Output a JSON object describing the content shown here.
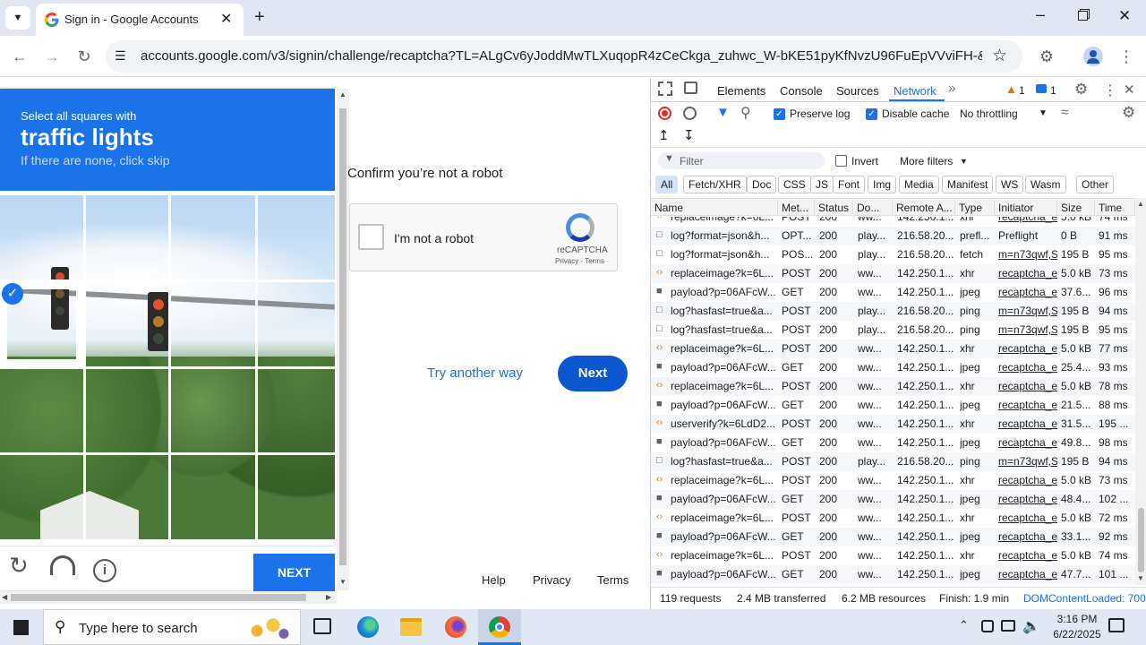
{
  "browser": {
    "tab_title": "Sign in - Google Accounts",
    "url": "accounts.google.com/v3/signin/challenge/recaptcha?TL=ALgCv6yJoddMwTLXuqopR4zCeCkga_zuhwc_W-bKE51pyKfNvzU96FuEpVVviFH-&checkConn..."
  },
  "captcha": {
    "instruction_small": "Select all squares with",
    "instruction_big": "traffic lights",
    "instruction_hint": "If there are none, click skip",
    "next_label": "NEXT",
    "selected_tiles": [
      3
    ]
  },
  "signin": {
    "confirm_text": "Confirm you’re not a robot",
    "checkbox_label": "I'm not a robot",
    "recaptcha_brand": "reCAPTCHA",
    "privacy_terms": "Privacy - Terms",
    "try_another": "Try another way",
    "next_button": "Next",
    "footer": [
      "Help",
      "Privacy",
      "Terms"
    ]
  },
  "devtools": {
    "tabs": [
      "Elements",
      "Console",
      "Sources",
      "Network"
    ],
    "active_tab": "Network",
    "warning_count": "1",
    "message_count": "1",
    "preserve_log": "Preserve log",
    "disable_cache": "Disable cache",
    "throttling": "No throttling",
    "filter_placeholder": "Filter",
    "invert": "Invert",
    "more_filters": "More filters",
    "type_filters": [
      "All",
      "Fetch/XHR",
      "Doc",
      "CSS",
      "JS",
      "Font",
      "Img",
      "Media",
      "Manifest",
      "WS",
      "Wasm",
      "Other"
    ],
    "columns": [
      "Name",
      "Met...",
      "Status",
      "Do...",
      "Remote A...",
      "Type",
      "Initiator",
      "Size",
      "Time"
    ],
    "rows": [
      {
        "icon": "xhr",
        "name": "replaceimage?k=6L...",
        "method": "POST",
        "status": "200",
        "domain": "ww...",
        "remote": "142.250.1...",
        "type": "xhr",
        "initiator": "recaptcha_e",
        "size": "5.0 kB",
        "time": "74 ms"
      },
      {
        "icon": "doc",
        "name": "log?format=json&h...",
        "method": "OPT...",
        "status": "200",
        "domain": "play...",
        "remote": "216.58.20...",
        "type": "prefl...",
        "initiator": "Preflight",
        "size": "0 B",
        "time": "91 ms"
      },
      {
        "icon": "doc",
        "name": "log?format=json&h...",
        "method": "POS...",
        "status": "200",
        "domain": "play...",
        "remote": "216.58.20...",
        "type": "fetch",
        "initiator": "m=n73qwf,S",
        "size": "195 B",
        "time": "95 ms"
      },
      {
        "icon": "xhr",
        "name": "replaceimage?k=6L...",
        "method": "POST",
        "status": "200",
        "domain": "ww...",
        "remote": "142.250.1...",
        "type": "xhr",
        "initiator": "recaptcha_e",
        "size": "5.0 kB",
        "time": "73 ms"
      },
      {
        "icon": "img",
        "name": "payload?p=06AFcW...",
        "method": "GET",
        "status": "200",
        "domain": "ww...",
        "remote": "142.250.1...",
        "type": "jpeg",
        "initiator": "recaptcha_e",
        "size": "37.6...",
        "time": "96 ms"
      },
      {
        "icon": "doc",
        "name": "log?hasfast=true&a...",
        "method": "POST",
        "status": "200",
        "domain": "play...",
        "remote": "216.58.20...",
        "type": "ping",
        "initiator": "m=n73qwf,S",
        "size": "195 B",
        "time": "94 ms"
      },
      {
        "icon": "doc",
        "name": "log?hasfast=true&a...",
        "method": "POST",
        "status": "200",
        "domain": "play...",
        "remote": "216.58.20...",
        "type": "ping",
        "initiator": "m=n73qwf,S",
        "size": "195 B",
        "time": "95 ms"
      },
      {
        "icon": "xhr",
        "name": "replaceimage?k=6L...",
        "method": "POST",
        "status": "200",
        "domain": "ww...",
        "remote": "142.250.1...",
        "type": "xhr",
        "initiator": "recaptcha_e",
        "size": "5.0 kB",
        "time": "77 ms"
      },
      {
        "icon": "img",
        "name": "payload?p=06AFcW...",
        "method": "GET",
        "status": "200",
        "domain": "ww...",
        "remote": "142.250.1...",
        "type": "jpeg",
        "initiator": "recaptcha_e",
        "size": "25.4...",
        "time": "93 ms"
      },
      {
        "icon": "xhr",
        "name": "replaceimage?k=6L...",
        "method": "POST",
        "status": "200",
        "domain": "ww...",
        "remote": "142.250.1...",
        "type": "xhr",
        "initiator": "recaptcha_e",
        "size": "5.0 kB",
        "time": "78 ms"
      },
      {
        "icon": "img",
        "name": "payload?p=06AFcW...",
        "method": "GET",
        "status": "200",
        "domain": "ww...",
        "remote": "142.250.1...",
        "type": "jpeg",
        "initiator": "recaptcha_e",
        "size": "21.5...",
        "time": "88 ms"
      },
      {
        "icon": "xhr",
        "name": "userverify?k=6LdD2...",
        "method": "POST",
        "status": "200",
        "domain": "ww...",
        "remote": "142.250.1...",
        "type": "xhr",
        "initiator": "recaptcha_e",
        "size": "31.5...",
        "time": "195 ..."
      },
      {
        "icon": "img",
        "name": "payload?p=06AFcW...",
        "method": "GET",
        "status": "200",
        "domain": "ww...",
        "remote": "142.250.1...",
        "type": "jpeg",
        "initiator": "recaptcha_e",
        "size": "49.8...",
        "time": "98 ms"
      },
      {
        "icon": "doc",
        "name": "log?hasfast=true&a...",
        "method": "POST",
        "status": "200",
        "domain": "play...",
        "remote": "216.58.20...",
        "type": "ping",
        "initiator": "m=n73qwf,S",
        "size": "195 B",
        "time": "94 ms"
      },
      {
        "icon": "xhr",
        "name": "replaceimage?k=6L...",
        "method": "POST",
        "status": "200",
        "domain": "ww...",
        "remote": "142.250.1...",
        "type": "xhr",
        "initiator": "recaptcha_e",
        "size": "5.0 kB",
        "time": "73 ms"
      },
      {
        "icon": "img",
        "name": "payload?p=06AFcW...",
        "method": "GET",
        "status": "200",
        "domain": "ww...",
        "remote": "142.250.1...",
        "type": "jpeg",
        "initiator": "recaptcha_e",
        "size": "48.4...",
        "time": "102 ..."
      },
      {
        "icon": "xhr",
        "name": "replaceimage?k=6L...",
        "method": "POST",
        "status": "200",
        "domain": "ww...",
        "remote": "142.250.1...",
        "type": "xhr",
        "initiator": "recaptcha_e",
        "size": "5.0 kB",
        "time": "72 ms"
      },
      {
        "icon": "img",
        "name": "payload?p=06AFcW...",
        "method": "GET",
        "status": "200",
        "domain": "ww...",
        "remote": "142.250.1...",
        "type": "jpeg",
        "initiator": "recaptcha_e",
        "size": "33.1...",
        "time": "92 ms"
      },
      {
        "icon": "xhr",
        "name": "replaceimage?k=6L...",
        "method": "POST",
        "status": "200",
        "domain": "ww...",
        "remote": "142.250.1...",
        "type": "xhr",
        "initiator": "recaptcha_e",
        "size": "5.0 kB",
        "time": "74 ms"
      },
      {
        "icon": "img",
        "name": "payload?p=06AFcW...",
        "method": "GET",
        "status": "200",
        "domain": "ww...",
        "remote": "142.250.1...",
        "type": "jpeg",
        "initiator": "recaptcha_e",
        "size": "47.7...",
        "time": "101 ..."
      }
    ],
    "status_bar": {
      "requests": "119 requests",
      "transferred": "2.4 MB transferred",
      "resources": "6.2 MB resources",
      "finish": "Finish: 1.9 min",
      "dom_loaded": "DOMContentLoaded: 700"
    }
  },
  "taskbar": {
    "search_placeholder": "Type here to search",
    "time": "3:16 PM",
    "date": "6/22/2025"
  },
  "colors": {
    "google_blue": "#1a73e8",
    "captcha_blue": "#1a73e8",
    "devtools_accent": "#1a73e8"
  }
}
